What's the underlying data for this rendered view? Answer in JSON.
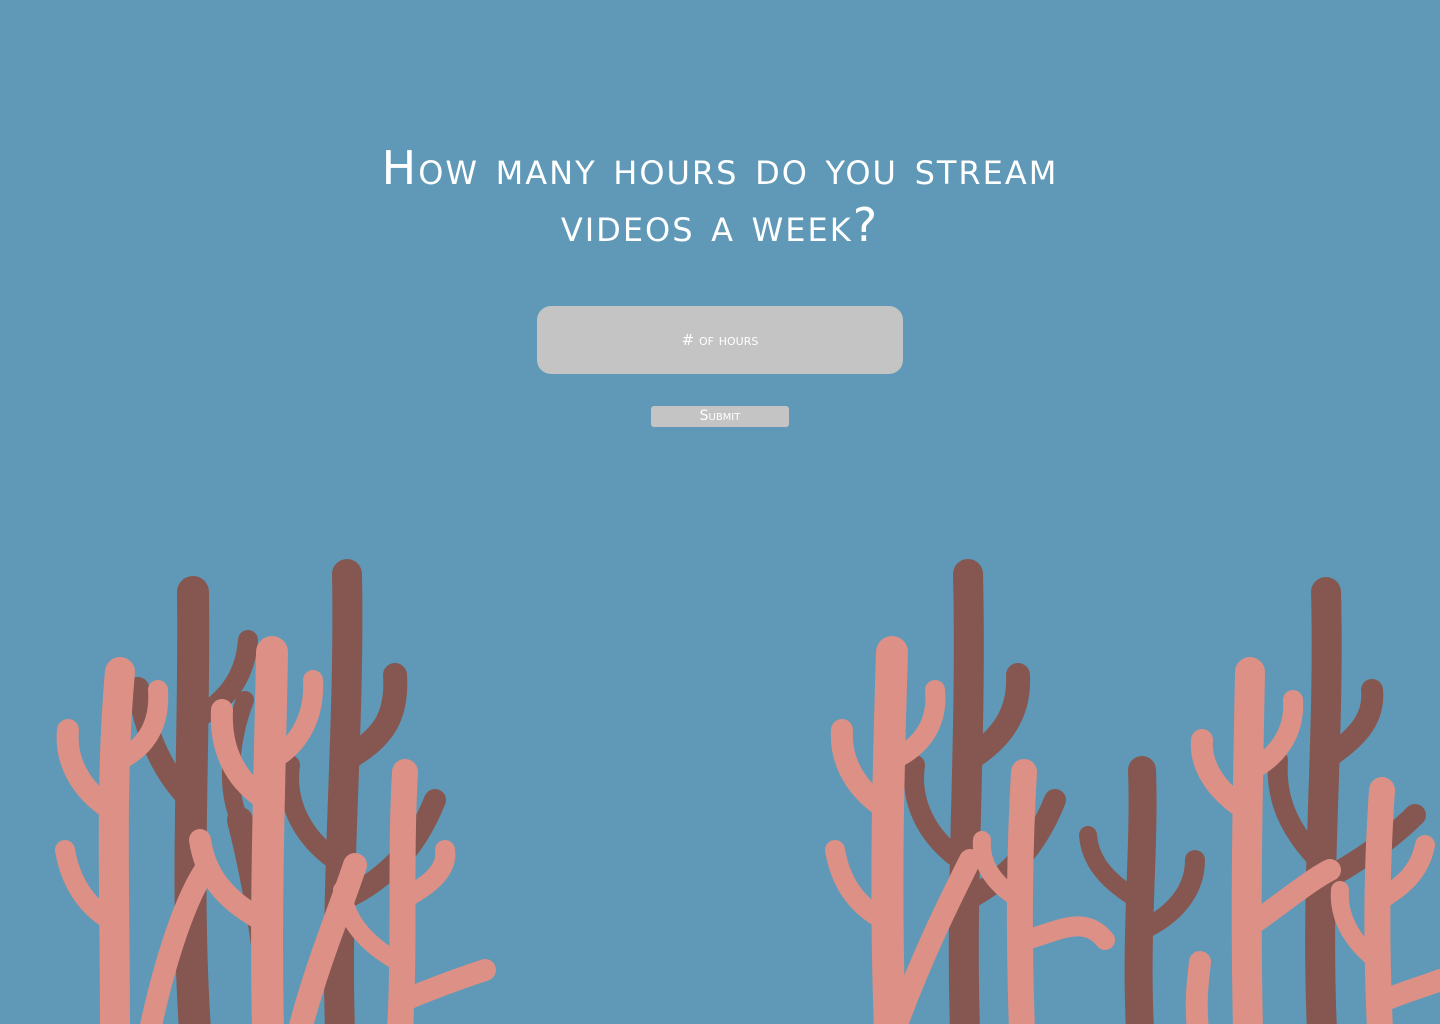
{
  "question": {
    "line1": "How many hours do you stream",
    "line2": "videos a week?"
  },
  "hours_input": {
    "placeholder": "# of hours",
    "value": ""
  },
  "submit": {
    "label": "Submit"
  },
  "colors": {
    "background": "#5f99b7",
    "input_fill": "#c4c4c4",
    "text": "#ffffff",
    "coral_dark": "#865750",
    "coral_light": "#dd9085"
  }
}
